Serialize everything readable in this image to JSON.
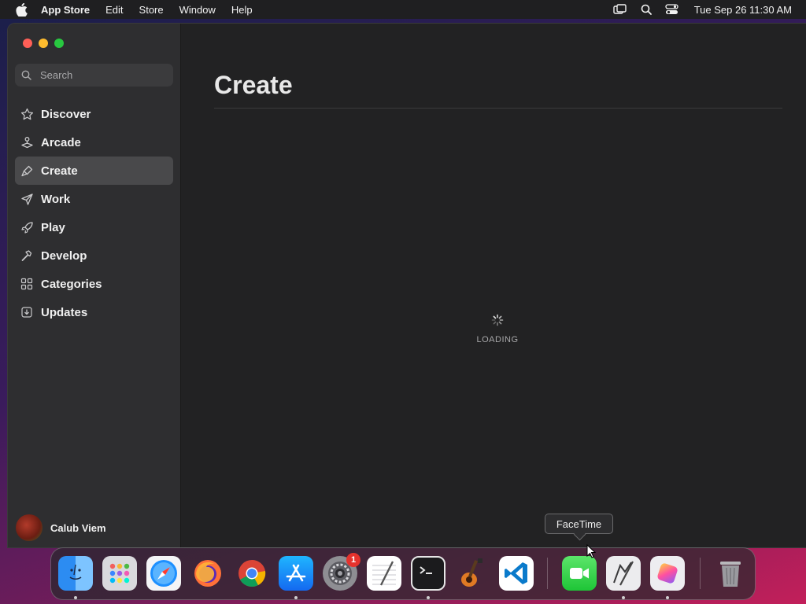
{
  "menubar": {
    "app_name": "App Store",
    "menus": [
      "Edit",
      "Store",
      "Window",
      "Help"
    ],
    "clock": "Tue Sep 26  11:30 AM"
  },
  "search": {
    "placeholder": "Search"
  },
  "sidebar": {
    "items": [
      {
        "label": "Discover",
        "icon": "star-icon"
      },
      {
        "label": "Arcade",
        "icon": "joystick-icon"
      },
      {
        "label": "Create",
        "icon": "brush-icon",
        "active": true
      },
      {
        "label": "Work",
        "icon": "paper-plane-icon"
      },
      {
        "label": "Play",
        "icon": "rocket-icon"
      },
      {
        "label": "Develop",
        "icon": "hammer-icon"
      },
      {
        "label": "Categories",
        "icon": "grid-icon"
      },
      {
        "label": "Updates",
        "icon": "download-icon"
      }
    ],
    "user": {
      "name": "Calub Viem"
    }
  },
  "main": {
    "title": "Create",
    "loading_text": "LOADING"
  },
  "tooltip": {
    "text": "FaceTime"
  },
  "dock": {
    "apps": [
      "Finder",
      "Launchpad",
      "Safari",
      "Firefox",
      "Chrome",
      "App Store",
      "System Settings",
      "TextEdit",
      "Terminal",
      "GarageBand",
      "Visual Studio Code",
      "FaceTime",
      "Script Editor",
      "Pixelmator",
      "Trash"
    ],
    "settings_badge": "1"
  },
  "colors": {
    "active_item": "#49494b",
    "close": "#ff5f57",
    "minimize": "#febc2e",
    "zoom": "#28c840",
    "badge": "#e5322d"
  }
}
